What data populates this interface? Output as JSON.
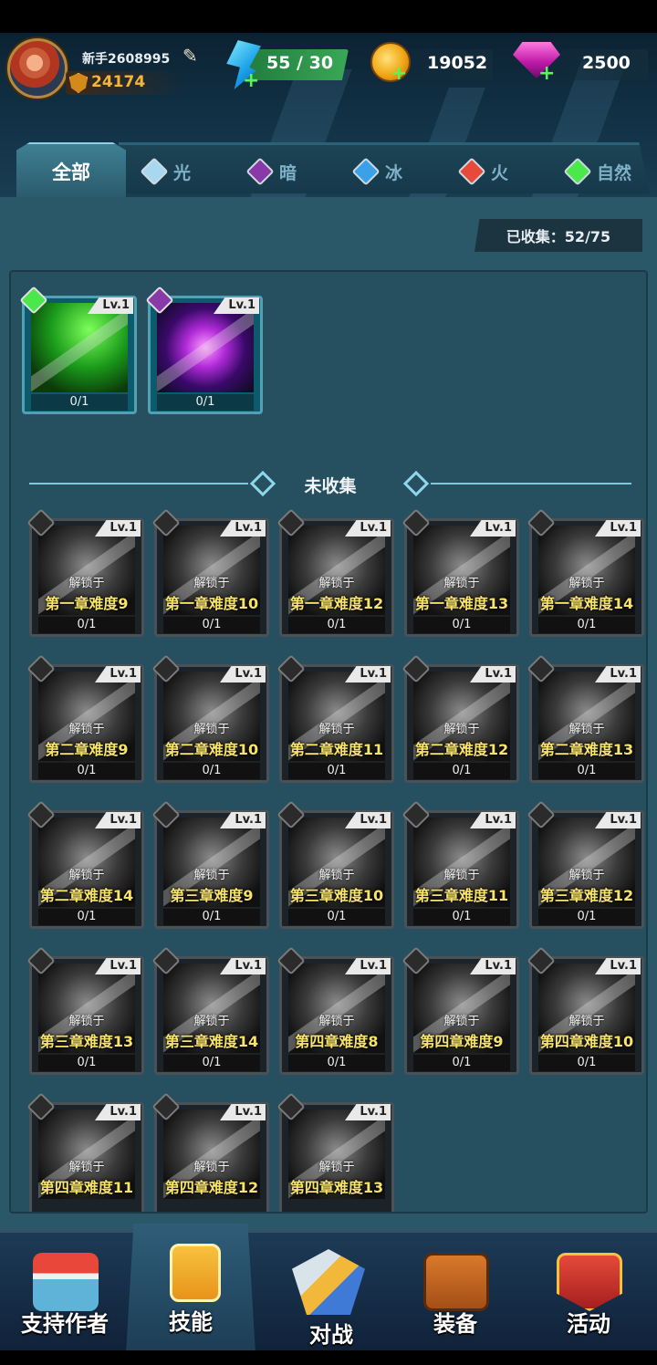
{
  "player": {
    "name": "新手2608995",
    "power": "24174"
  },
  "resources": {
    "energy": "55 / 30",
    "gold": "19052",
    "gems": "2500"
  },
  "tabs": [
    {
      "label": "全部"
    },
    {
      "label": "光",
      "color": "#a8d8f0"
    },
    {
      "label": "暗",
      "color": "#8a3aa8"
    },
    {
      "label": "冰",
      "color": "#3aa0e8"
    },
    {
      "label": "火",
      "color": "#e84a3a"
    },
    {
      "label": "自然",
      "color": "#4ae84a"
    }
  ],
  "collected_label": "已收集：52/75",
  "collected_cards": [
    {
      "level": "Lv.1",
      "count": "0/1",
      "element": "nature"
    },
    {
      "level": "Lv.1",
      "count": "0/1",
      "element": "dark"
    }
  ],
  "uncollected_title": "未收集",
  "unlock_prefix": "解锁于",
  "uncollected_cards": [
    {
      "level": "Lv.1",
      "unlock": "第一章难度9",
      "count": "0/1"
    },
    {
      "level": "Lv.1",
      "unlock": "第一章难度10",
      "count": "0/1"
    },
    {
      "level": "Lv.1",
      "unlock": "第一章难度12",
      "count": "0/1"
    },
    {
      "level": "Lv.1",
      "unlock": "第一章难度13",
      "count": "0/1"
    },
    {
      "level": "Lv.1",
      "unlock": "第一章难度14",
      "count": "0/1"
    },
    {
      "level": "Lv.1",
      "unlock": "第二章难度9",
      "count": "0/1"
    },
    {
      "level": "Lv.1",
      "unlock": "第二章难度10",
      "count": "0/1"
    },
    {
      "level": "Lv.1",
      "unlock": "第二章难度11",
      "count": "0/1"
    },
    {
      "level": "Lv.1",
      "unlock": "第二章难度12",
      "count": "0/1"
    },
    {
      "level": "Lv.1",
      "unlock": "第二章难度13",
      "count": "0/1"
    },
    {
      "level": "Lv.1",
      "unlock": "第二章难度14",
      "count": "0/1"
    },
    {
      "level": "Lv.1",
      "unlock": "第三章难度9",
      "count": "0/1"
    },
    {
      "level": "Lv.1",
      "unlock": "第三章难度10",
      "count": "0/1"
    },
    {
      "level": "Lv.1",
      "unlock": "第三章难度11",
      "count": "0/1"
    },
    {
      "level": "Lv.1",
      "unlock": "第三章难度12",
      "count": "0/1"
    },
    {
      "level": "Lv.1",
      "unlock": "第三章难度13",
      "count": "0/1"
    },
    {
      "level": "Lv.1",
      "unlock": "第三章难度14",
      "count": "0/1"
    },
    {
      "level": "Lv.1",
      "unlock": "第四章难度8",
      "count": "0/1"
    },
    {
      "level": "Lv.1",
      "unlock": "第四章难度9",
      "count": "0/1"
    },
    {
      "level": "Lv.1",
      "unlock": "第四章难度10",
      "count": "0/1"
    },
    {
      "level": "Lv.1",
      "unlock": "第四章难度11",
      "count": ""
    },
    {
      "level": "Lv.1",
      "unlock": "第四章难度12",
      "count": ""
    },
    {
      "level": "Lv.1",
      "unlock": "第四章难度13",
      "count": ""
    }
  ],
  "bottom_nav": [
    {
      "label": "支持作者",
      "icon": "shop-icon"
    },
    {
      "label": "技能",
      "icon": "skill-card-icon"
    },
    {
      "label": "对战",
      "icon": "battle-swords-icon"
    },
    {
      "label": "装备",
      "icon": "backpack-icon"
    },
    {
      "label": "活动",
      "icon": "event-shield-icon"
    }
  ]
}
